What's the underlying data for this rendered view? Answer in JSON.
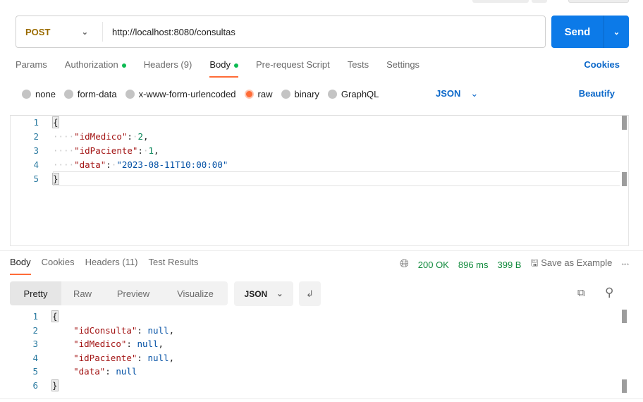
{
  "request": {
    "method": "POST",
    "url": "http://localhost:8080/consultas",
    "send_label": "Send"
  },
  "request_tabs": [
    {
      "label": "Params"
    },
    {
      "label": "Authorization",
      "dot": true
    },
    {
      "label": "Headers (9)"
    },
    {
      "label": "Body",
      "dot": true,
      "active": true
    },
    {
      "label": "Pre-request Script"
    },
    {
      "label": "Tests"
    },
    {
      "label": "Settings"
    }
  ],
  "cookies_label": "Cookies",
  "body_types": [
    {
      "label": "none"
    },
    {
      "label": "form-data"
    },
    {
      "label": "x-www-form-urlencoded"
    },
    {
      "label": "raw",
      "selected": true
    },
    {
      "label": "binary"
    },
    {
      "label": "GraphQL"
    }
  ],
  "body_format": "JSON",
  "beautify_label": "Beautify",
  "request_body": {
    "open": "{",
    "close": "}",
    "fields": [
      {
        "key": "\"idMedico\"",
        "value": "2",
        "type": "n",
        "comma": true
      },
      {
        "key": "\"idPaciente\"",
        "value": "1",
        "type": "n",
        "comma": true
      },
      {
        "key": "\"data\"",
        "value": "\"2023-08-11T10:00:00\"",
        "type": "s",
        "comma": false
      }
    ]
  },
  "response_tabs": [
    {
      "label": "Body",
      "active": true
    },
    {
      "label": "Cookies"
    },
    {
      "label": "Headers (11)"
    },
    {
      "label": "Test Results"
    }
  ],
  "response_status": {
    "code": "200 OK",
    "time": "896 ms",
    "size": "399 B",
    "save_label": "Save as Example"
  },
  "view_modes": [
    {
      "label": "Pretty",
      "active": true
    },
    {
      "label": "Raw"
    },
    {
      "label": "Preview"
    },
    {
      "label": "Visualize"
    }
  ],
  "response_format": "JSON",
  "response_body": {
    "open": "{",
    "close": "}",
    "fields": [
      {
        "key": "\"idConsulta\"",
        "value": "null",
        "type": "kw",
        "comma": true
      },
      {
        "key": "\"idMedico\"",
        "value": "null",
        "type": "kw",
        "comma": true
      },
      {
        "key": "\"idPaciente\"",
        "value": "null",
        "type": "kw",
        "comma": true
      },
      {
        "key": "\"data\"",
        "value": "null",
        "type": "kw",
        "comma": false
      }
    ]
  },
  "colors": {
    "accent": "#ff6c37",
    "send": "#0c7ae8",
    "status_ok": "#108a3c"
  }
}
